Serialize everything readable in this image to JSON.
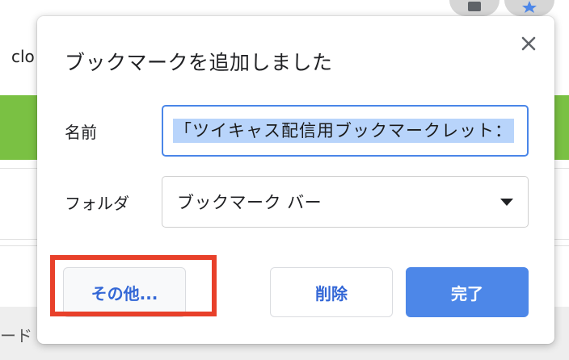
{
  "background": {
    "left_text": "clo",
    "bottom_text": "ード",
    "accent_green": "#7ac143"
  },
  "toolbar_icons": [
    "profile-icon",
    "star-icon"
  ],
  "dialog": {
    "title": "ブックマークを追加しました",
    "close_icon": "close-icon",
    "name_label": "名前",
    "name_value": "「ツイキャス配信用ブックマークレット：",
    "folder_label": "フォルダ",
    "folder_value": "ブックマーク バー",
    "buttons": {
      "more": "その他...",
      "delete": "削除",
      "done": "完了"
    },
    "colors": {
      "primary": "#4d87e8",
      "link": "#3367d6",
      "highlight_box": "#e8402a"
    }
  }
}
